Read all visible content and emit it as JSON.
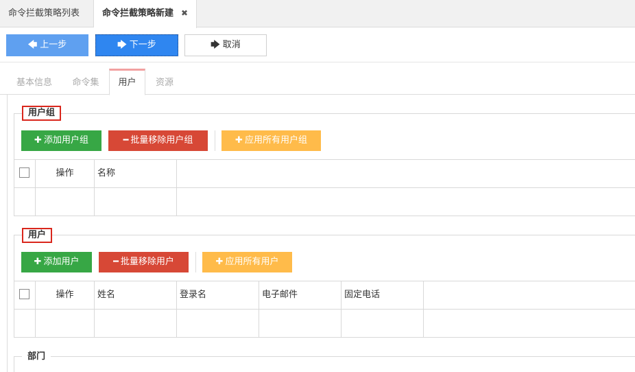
{
  "top_tabs": [
    {
      "label": "命令拦截策略列表"
    },
    {
      "label": "命令拦截策略新建",
      "close": "✖"
    }
  ],
  "toolbar": {
    "prev_label": "上一步",
    "next_label": "下一步",
    "cancel_label": "取消"
  },
  "steps": [
    "基本信息",
    "命令集",
    "用户",
    "资源"
  ],
  "user_group": {
    "legend": "用户组",
    "add_label": "添加用户组",
    "remove_label": "批量移除用户组",
    "apply_label": "应用所有用户组",
    "columns": [
      "操作",
      "名称"
    ]
  },
  "users": {
    "legend": "用户",
    "add_label": "添加用户",
    "remove_label": "批量移除用户",
    "apply_label": "应用所有用户",
    "columns": [
      "操作",
      "姓名",
      "登录名",
      "电子邮件",
      "固定电话"
    ]
  },
  "department": {
    "legend": "部门"
  },
  "colors": {
    "green": "#37a745",
    "red": "#d74836",
    "orange": "#ffbb4a",
    "primary": "#2f86f0",
    "highlight": "#d9261c"
  }
}
